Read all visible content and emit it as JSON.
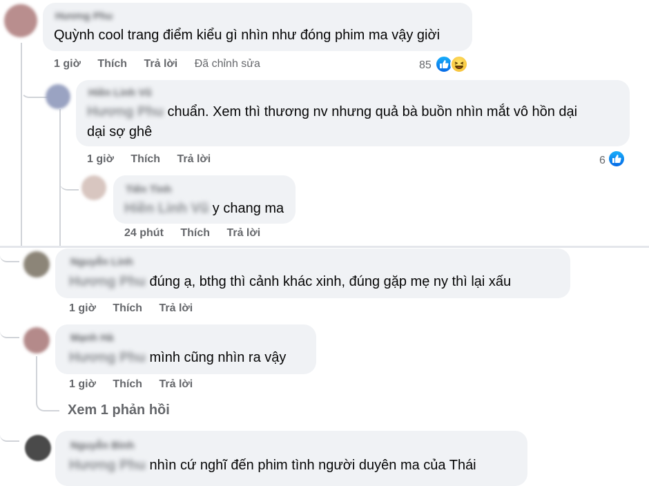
{
  "comments": [
    {
      "id": "c1",
      "author": "Hương Phu",
      "text": "Quỳnh cool trang điểm kiểu gì nhìn như đóng phim ma vậy giời",
      "time": "1 giờ",
      "like": "Thích",
      "reply": "Trả lời",
      "edited": "Đã chỉnh sửa",
      "reactions": "85",
      "avatar_color": "#b98e8e"
    },
    {
      "id": "c2",
      "author": "Hiền Linh Vũ",
      "tag": "Hương Phu",
      "text_line1": "chuẩn. Xem thì thương nv nhưng quả bà buồn nhìn mắt vô hồn dại",
      "text_line2": "dại sợ ghê",
      "time": "1 giờ",
      "like": "Thích",
      "reply": "Trả lời",
      "reactions": "6",
      "avatar_color": "#9aa3c2"
    },
    {
      "id": "c3",
      "author": "Tiến Tình",
      "tag": "Hiền Linh Vũ",
      "text": "y chang ma",
      "time": "24 phút",
      "like": "Thích",
      "reply": "Trả lời",
      "avatar_color": "#d8c6c0"
    },
    {
      "id": "c4",
      "author": "Nguyễn Linh",
      "tag": "Hương Phu",
      "text": "đúng ạ, bthg thì cảnh khác xinh, đúng gặp mẹ ny thì lại xấu",
      "time": "1 giờ",
      "like": "Thích",
      "reply": "Trả lời",
      "avatar_color": "#8c8578"
    },
    {
      "id": "c5",
      "author": "Mạnh Hà",
      "tag": "Hương Phu",
      "text": "mình cũng nhìn ra vậy",
      "time": "1 giờ",
      "like": "Thích",
      "reply": "Trả lời",
      "view_replies": "Xem 1 phản hồi",
      "avatar_color": "#b48a8a"
    },
    {
      "id": "c6",
      "author": "Nguyễn Bình",
      "tag": "Hương Phu",
      "text": "nhìn cứ nghĩ đến phim tình người duyên ma của Thái",
      "avatar_color": "#4a4a4a"
    }
  ],
  "colors": {
    "bubble": "#f0f2f5",
    "action_text": "#65676b",
    "like_blue": "#1877f2"
  },
  "icons": [
    "like-reaction-icon",
    "haha-reaction-icon"
  ]
}
